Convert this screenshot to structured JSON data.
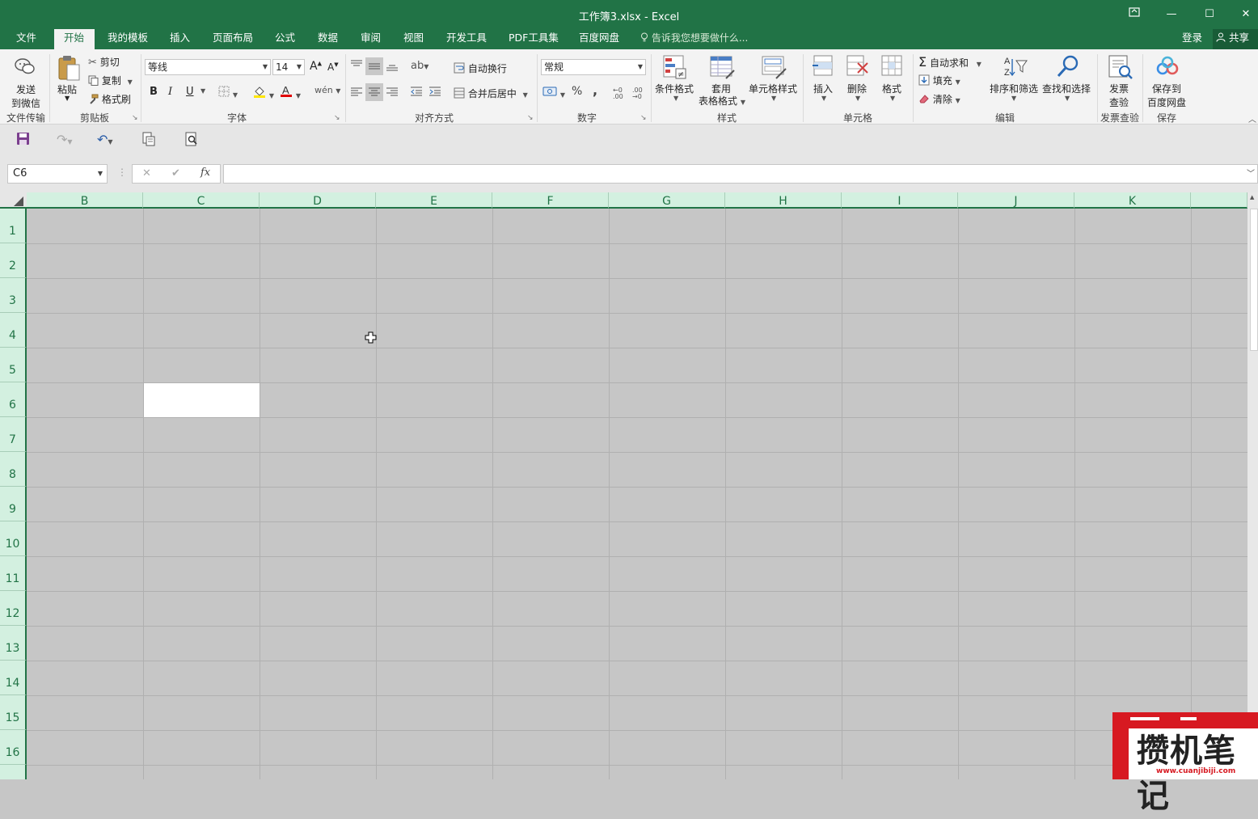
{
  "window": {
    "title": "工作簿3.xlsx - Excel",
    "restore_ribbon_icon": "ribbon-display-icon",
    "minimize": "—",
    "maximize": "☐",
    "close": "✕"
  },
  "menu": {
    "items": [
      "文件",
      "开始",
      "我的模板",
      "插入",
      "页面布局",
      "公式",
      "数据",
      "审阅",
      "视图",
      "开发工具",
      "PDF工具集",
      "百度网盘"
    ],
    "active": "开始",
    "tell_me": "告诉我您想要做什么...",
    "login": "登录",
    "share": "共享"
  },
  "ribbon": {
    "file_transfer": {
      "send": "发送",
      "send2": "到微信",
      "group": "文件传输"
    },
    "clipboard": {
      "paste": "粘贴",
      "cut": "剪切",
      "copy": "复制",
      "format_painter": "格式刷",
      "group": "剪贴板"
    },
    "font": {
      "name": "等线",
      "size": "14",
      "bold": "B",
      "italic": "I",
      "underline": "U",
      "grow": "A",
      "shrink": "A",
      "group": "字体"
    },
    "alignment": {
      "wrap": "自动换行",
      "merge": "合并后居中",
      "group": "对齐方式"
    },
    "number": {
      "format": "常规",
      "percent": "%",
      "comma": ",",
      "group": "数字"
    },
    "styles": {
      "conditional": "条件格式",
      "table1": "套用",
      "table2": "表格格式",
      "cell_styles": "单元格样式",
      "group": "样式"
    },
    "cells": {
      "insert": "插入",
      "delete": "删除",
      "format": "格式",
      "group": "单元格"
    },
    "editing": {
      "autosum": "自动求和",
      "fill": "填充",
      "clear": "清除",
      "sort": "排序和筛选",
      "find": "查找和选择",
      "group": "编辑"
    },
    "invoice": {
      "btn1": "发票",
      "btn2": "查验",
      "group": "发票查验"
    },
    "save": {
      "btn1": "保存到",
      "btn2": "百度网盘",
      "group": "保存"
    }
  },
  "formula_bar": {
    "name_box": "C6",
    "cancel": "✕",
    "enter": "✔",
    "fx": "fx",
    "content": ""
  },
  "sheet": {
    "columns": [
      "B",
      "C",
      "D",
      "E",
      "F",
      "G",
      "H",
      "I",
      "J",
      "K"
    ],
    "rows": [
      "1",
      "2",
      "3",
      "4",
      "5",
      "6",
      "7",
      "8",
      "9",
      "10",
      "11",
      "12",
      "13",
      "14",
      "15",
      "16"
    ],
    "selected_cell": "C6"
  },
  "watermark": {
    "text": "攒机笔记",
    "url": "www.cuanjibiji.com"
  },
  "colors": {
    "accent": "#217346",
    "header_bg": "#d3f0e0",
    "sheet_bg": "#c6c6c6"
  }
}
